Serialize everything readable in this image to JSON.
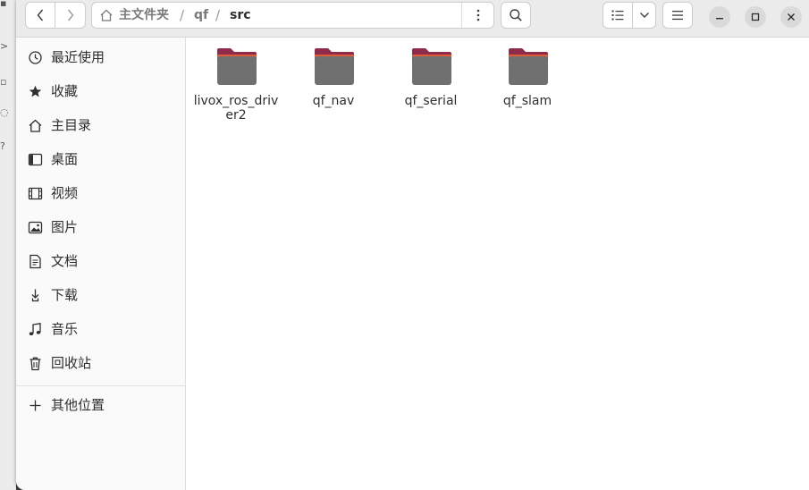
{
  "path": {
    "crumbs": [
      "主文件夹",
      "qf",
      "src"
    ]
  },
  "sidebar": {
    "items": [
      {
        "label": "最近使用",
        "icon": "clock-icon"
      },
      {
        "label": "收藏",
        "icon": "star-icon"
      },
      {
        "label": "主目录",
        "icon": "home-icon"
      },
      {
        "label": "桌面",
        "icon": "desktop-icon"
      },
      {
        "label": "视频",
        "icon": "video-icon"
      },
      {
        "label": "图片",
        "icon": "image-icon"
      },
      {
        "label": "文档",
        "icon": "document-icon"
      },
      {
        "label": "下载",
        "icon": "download-icon"
      },
      {
        "label": "音乐",
        "icon": "music-icon"
      },
      {
        "label": "回收站",
        "icon": "trash-icon"
      }
    ],
    "other_locations": {
      "label": "其他位置",
      "icon": "plus-icon"
    }
  },
  "files": [
    {
      "name": "livox_ros_driver2",
      "type": "folder"
    },
    {
      "name": "qf_nav",
      "type": "folder"
    },
    {
      "name": "qf_serial",
      "type": "folder"
    },
    {
      "name": "qf_slam",
      "type": "folder"
    }
  ],
  "colors": {
    "folder_body": "#707070",
    "folder_tab": "#e05a3b",
    "folder_back": "#8e2a4a"
  }
}
